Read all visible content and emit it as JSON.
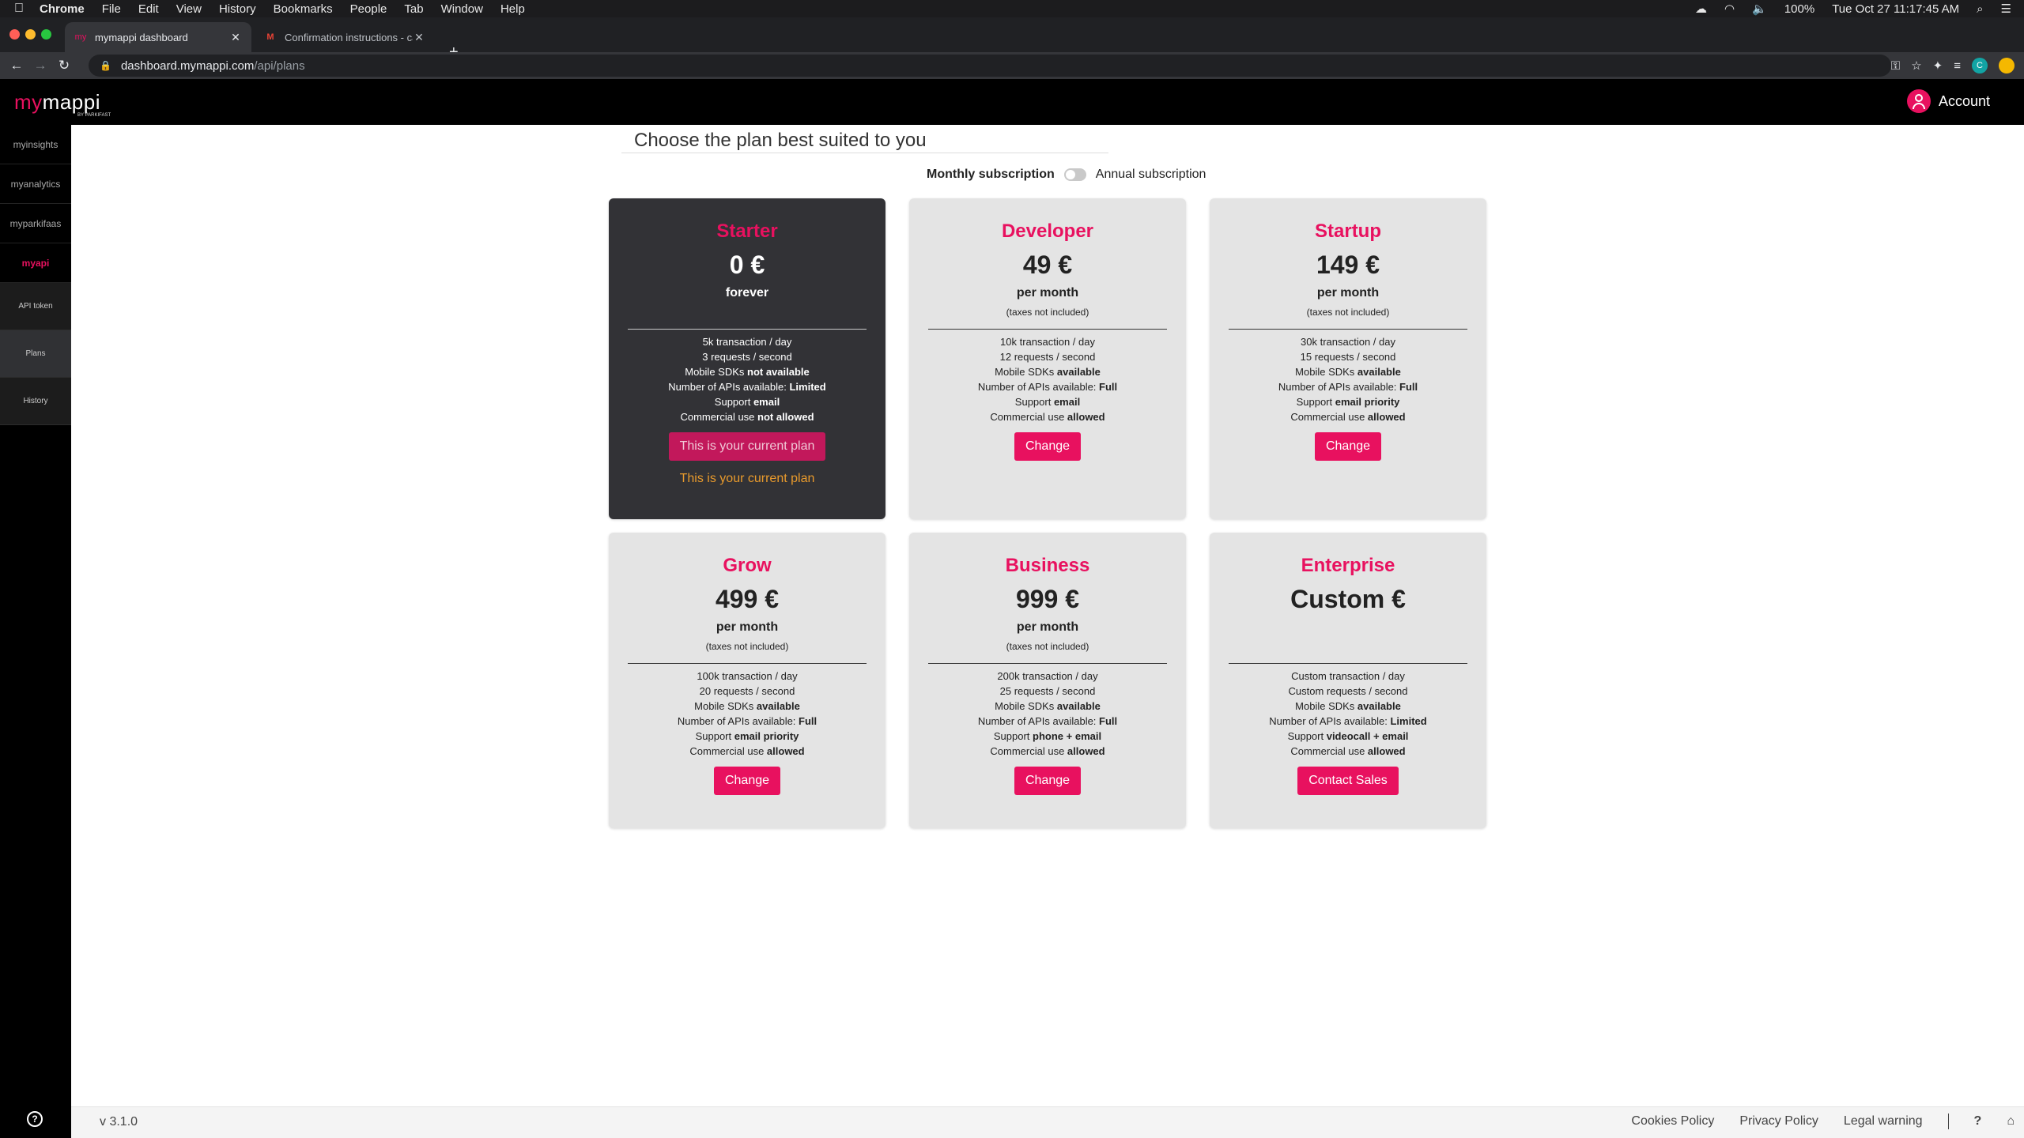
{
  "menubar": {
    "app": "Chrome",
    "items": [
      "File",
      "Edit",
      "View",
      "History",
      "Bookmarks",
      "People",
      "Tab",
      "Window",
      "Help"
    ],
    "battery": "100%",
    "datetime": "Tue Oct 27  11:17:45 AM"
  },
  "browser": {
    "tabs": [
      {
        "title": "mymappi dashboard"
      },
      {
        "title": "Confirmation instructions - ca"
      }
    ],
    "url_host": "dashboard.mymappi.com",
    "url_path": "/api/plans",
    "profile_initial": "C"
  },
  "header": {
    "logo_my": "my",
    "logo_rest": "mappi",
    "logo_sub": "BY PARKIFAST",
    "account_label": "Account"
  },
  "sidebar": {
    "apps": [
      "myinsights",
      "myanalytics",
      "myparkifaas",
      "myapi"
    ],
    "sub_items": [
      "API token",
      "Plans",
      "History"
    ],
    "help": "?"
  },
  "main": {
    "heading": "Choose the plan best suited to you",
    "toggle": {
      "monthly": "Monthly subscription",
      "annual": "Annual subscription"
    }
  },
  "plans": [
    {
      "name": "Starter",
      "price": "0 €",
      "period": "forever",
      "tax": "",
      "features": [
        [
          "5k transaction / day",
          ""
        ],
        [
          "3 requests / second",
          ""
        ],
        [
          "Mobile SDKs ",
          "not available"
        ],
        [
          "Number of APIs available: ",
          "Limited"
        ],
        [
          "Support ",
          "email"
        ],
        [
          "Commercial use ",
          "not allowed"
        ]
      ],
      "button": "This is your current plan",
      "note": "This is your current plan"
    },
    {
      "name": "Developer",
      "price": "49 €",
      "period": "per month",
      "tax": "(taxes not included)",
      "features": [
        [
          "10k transaction / day",
          ""
        ],
        [
          "12 requests / second",
          ""
        ],
        [
          "Mobile SDKs ",
          "available"
        ],
        [
          "Number of APIs available: ",
          "Full"
        ],
        [
          "Support ",
          "email"
        ],
        [
          "Commercial use ",
          "allowed"
        ]
      ],
      "button": "Change"
    },
    {
      "name": "Startup",
      "price": "149 €",
      "period": "per month",
      "tax": "(taxes not included)",
      "features": [
        [
          "30k transaction / day",
          ""
        ],
        [
          "15 requests / second",
          ""
        ],
        [
          "Mobile SDKs ",
          "available"
        ],
        [
          "Number of APIs available: ",
          "Full"
        ],
        [
          "Support ",
          "email priority"
        ],
        [
          "Commercial use ",
          "allowed"
        ]
      ],
      "button": "Change"
    },
    {
      "name": "Grow",
      "price": "499 €",
      "period": "per month",
      "tax": "(taxes not included)",
      "features": [
        [
          "100k transaction / day",
          ""
        ],
        [
          "20 requests / second",
          ""
        ],
        [
          "Mobile SDKs ",
          "available"
        ],
        [
          "Number of APIs available: ",
          "Full"
        ],
        [
          "Support ",
          "email priority"
        ],
        [
          "Commercial use ",
          "allowed"
        ]
      ],
      "button": "Change"
    },
    {
      "name": "Business",
      "price": "999 €",
      "period": "per month",
      "tax": "(taxes not included)",
      "features": [
        [
          "200k transaction / day",
          ""
        ],
        [
          "25 requests / second",
          ""
        ],
        [
          "Mobile SDKs ",
          "available"
        ],
        [
          "Number of APIs available: ",
          "Full"
        ],
        [
          "Support ",
          "phone + email"
        ],
        [
          "Commercial use ",
          "allowed"
        ]
      ],
      "button": "Change"
    },
    {
      "name": "Enterprise",
      "price": "Custom €",
      "period": "",
      "tax": "",
      "features": [
        [
          "Custom transaction / day",
          ""
        ],
        [
          "Custom requests / second",
          ""
        ],
        [
          "Mobile SDKs ",
          "available"
        ],
        [
          "Number of APIs available: ",
          "Limited"
        ],
        [
          "Support ",
          "videocall + email"
        ],
        [
          "Commercial use ",
          "allowed"
        ]
      ],
      "button": "Contact Sales"
    }
  ],
  "footer": {
    "version": "v 3.1.0",
    "links": [
      "Cookies Policy",
      "Privacy Policy",
      "Legal warning"
    ],
    "help": "?"
  },
  "colors": {
    "brand": "#e8115f",
    "current_note": "#e89a2c",
    "current_card": "#323236"
  }
}
